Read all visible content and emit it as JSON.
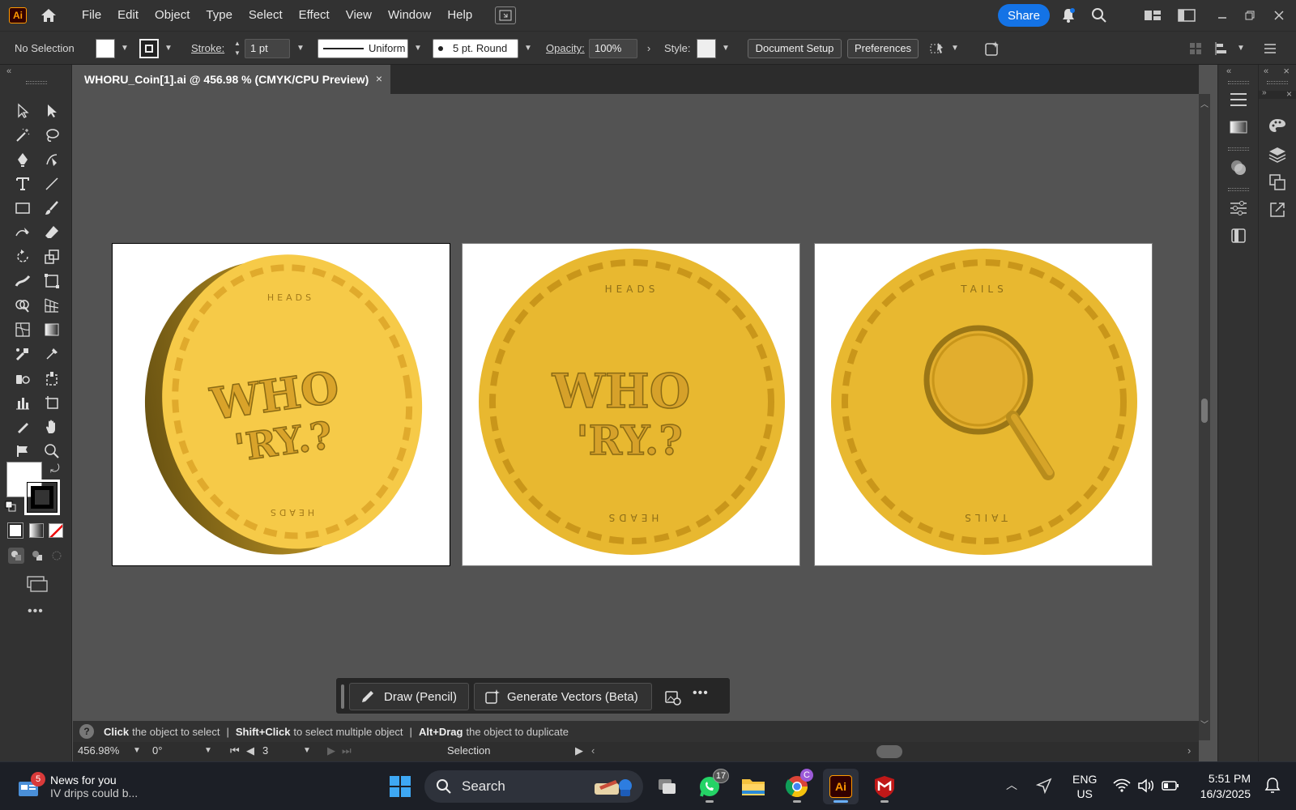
{
  "menubar": {
    "logo": "Ai",
    "items": [
      "File",
      "Edit",
      "Object",
      "Type",
      "Select",
      "Effect",
      "View",
      "Window",
      "Help"
    ],
    "share_label": "Share"
  },
  "controlbar": {
    "selection": "No Selection",
    "stroke_label": "Stroke:",
    "stroke_value": "1 pt",
    "stroke_profile": "Uniform",
    "brush": "5 pt. Round",
    "opacity_label": "Opacity:",
    "opacity_value": "100%",
    "style_label": "Style:",
    "document_setup": "Document Setup",
    "preferences": "Preferences"
  },
  "document": {
    "tab_title": "WHORU_Coin[1].ai @ 456.98 % (CMYK/CPU Preview)",
    "close": "×"
  },
  "artboards": [
    {
      "top_text": "HEADS",
      "bottom_text": "HEADS",
      "logo_line1": "WHO",
      "logo_line2": "'RY.?"
    },
    {
      "top_text": "HEADS",
      "bottom_text": "HEADS",
      "logo_line1": "WHO",
      "logo_line2": "'RY.?"
    },
    {
      "top_text": "TAILS",
      "bottom_text": "TAILS"
    }
  ],
  "colors": {
    "coin": "#e8b830",
    "coin_dark": "#c9961a",
    "coin_light": "#f3c744",
    "accent": "#1473e6"
  },
  "context_bar": {
    "draw": "Draw (Pencil)",
    "generate": "Generate Vectors (Beta)",
    "more": "•••"
  },
  "hint": {
    "b1": "Click",
    "t1": "the object to select",
    "b2": "Shift+Click",
    "t2": "to select multiple object",
    "b3": "Alt+Drag",
    "t3": "the object to duplicate",
    "sep": "|"
  },
  "status": {
    "zoom": "456.98%",
    "rotation": "0°",
    "artboard": "3",
    "tool": "Selection"
  },
  "taskbar": {
    "news_badge": "5",
    "news_title": "News for you",
    "news_sub": "IV drips could b...",
    "search": "Search",
    "whatsapp_badge": "17",
    "chrome_badge": "C",
    "ai_label": "Ai",
    "lang1": "ENG",
    "lang2": "US",
    "time": "5:51 PM",
    "date": "16/3/2025"
  }
}
